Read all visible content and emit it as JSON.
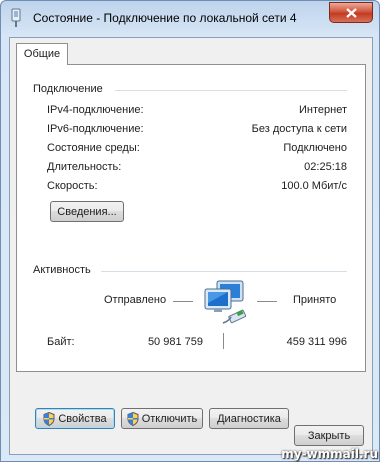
{
  "window": {
    "title": "Состояние - Подключение по локальной сети 4"
  },
  "tabs": [
    {
      "label": "Общие"
    }
  ],
  "connection": {
    "group_label": "Подключение",
    "rows": [
      {
        "label": "IPv4-подключение:",
        "value": "Интернет"
      },
      {
        "label": "IPv6-подключение:",
        "value": "Без доступа к сети"
      },
      {
        "label": "Состояние среды:",
        "value": "Подключено"
      },
      {
        "label": "Длительность:",
        "value": "02:25:18"
      },
      {
        "label": "Скорость:",
        "value": "100.0 Мбит/с"
      }
    ],
    "details_button": "Сведения..."
  },
  "activity": {
    "group_label": "Активность",
    "sent_label": "Отправлено",
    "received_label": "Принято",
    "bytes_label": "Байт:",
    "bytes_sent": "50 981 759",
    "bytes_received": "459 311 996"
  },
  "buttons": {
    "properties": "Свойства",
    "disable": "Отключить",
    "diagnose": "Диагностика",
    "close": "Закрыть"
  },
  "watermark": "my-wmmail.ru",
  "icons": {
    "title": "network-status-icon",
    "activity": "network-computers-icon",
    "shield": "uac-shield-icon"
  }
}
